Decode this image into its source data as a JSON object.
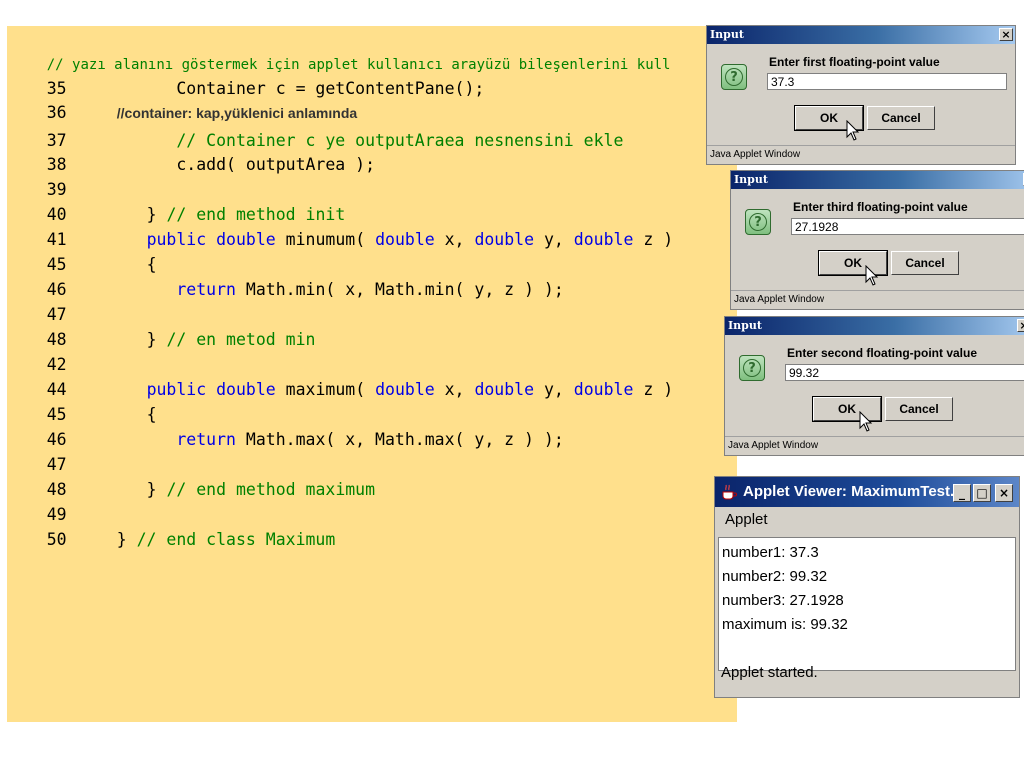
{
  "code": {
    "header_comment": "// yazı alanını göstermek için applet kullanıcı arayüzü bileşenlerini kull",
    "lines": [
      {
        "num": "35",
        "text": "   Container c = getContentPane();"
      },
      {
        "num": "36",
        "note": "//container: kap,yüklenici anlamında"
      },
      {
        "num": "37",
        "text": "   // Container c ye outputAraea nesnensini ekle"
      },
      {
        "num": "38",
        "text": "   c.add( outputArea );"
      },
      {
        "num": "39",
        "text": ""
      },
      {
        "num": "40",
        "text": "} // end method init"
      },
      {
        "num": "41",
        "text": "public double minumum( double x, double y, double z )"
      },
      {
        "num": "45",
        "text": "{"
      },
      {
        "num": "46",
        "text": "return Math.min( x, Math.min( y, z ) );"
      },
      {
        "num": "47",
        "text": ""
      },
      {
        "num": "48",
        "text": "} // en metod min"
      },
      {
        "num": "42",
        "text": ""
      },
      {
        "num": "44",
        "text": "public double maximum( double x, double y, double z )"
      },
      {
        "num": "45",
        "text": "{"
      },
      {
        "num": "46",
        "text": "return Math.max( x, Math.max( y, z ) );"
      },
      {
        "num": "47",
        "text": ""
      },
      {
        "num": "48",
        "text": "} // end method maximum"
      },
      {
        "num": "49",
        "text": ""
      },
      {
        "num": "50",
        "text": "} // end class Maximum"
      }
    ],
    "tokens": {
      "container_c": "Container c = getContentPane();",
      "comment_37": "// Container c ye outputAraea nesnensini ekle",
      "add_stmt": "c.add( outputArea );",
      "brace_close": "}",
      "comment_40": "// end method init",
      "public": "public",
      "double": "double",
      "sig_min_name": "minumum(",
      "x_comma": "x,",
      "y_comma": "y,",
      "z_paren": "z )",
      "brace_open": "{",
      "return": "return",
      "min_expr": "Math.min( x, Math.min( y, z ) );",
      "comment_48": "// en metod min",
      "sig_max_name": "maximum(",
      "max_expr": "Math.max( x, Math.max( y, z ) );",
      "comment_48b": "// end method maximum",
      "comment_50": "// end class Maximum"
    }
  },
  "dialogs": {
    "first": {
      "title": "Input",
      "prompt": "Enter first floating-point value",
      "value": "37.3",
      "ok": "OK",
      "cancel": "Cancel",
      "status": "Java Applet Window",
      "close": "×"
    },
    "third": {
      "title": "Input",
      "prompt": "Enter third floating-point value",
      "value": "27.1928",
      "ok": "OK",
      "cancel": "Cancel",
      "status": "Java Applet Window",
      "close": "×"
    },
    "second": {
      "title": "Input",
      "prompt": "Enter second floating-point value",
      "value": "99.32",
      "ok": "OK",
      "cancel": "Cancel",
      "status": "Java Applet Window",
      "close": "×"
    }
  },
  "viewer": {
    "title": "Applet Viewer: MaximumTest....",
    "menu": "Applet",
    "output": [
      "number1: 37.3",
      "number2: 99.32",
      "number3: 27.1928",
      "maximum is: 99.32"
    ],
    "status": "Applet started.",
    "min": "_",
    "max": "□",
    "close": "×"
  },
  "colors": {
    "code_background": "#ffe08c",
    "keyword": "#0000e6",
    "comment": "#008000",
    "titlebar": "#0a246a"
  }
}
